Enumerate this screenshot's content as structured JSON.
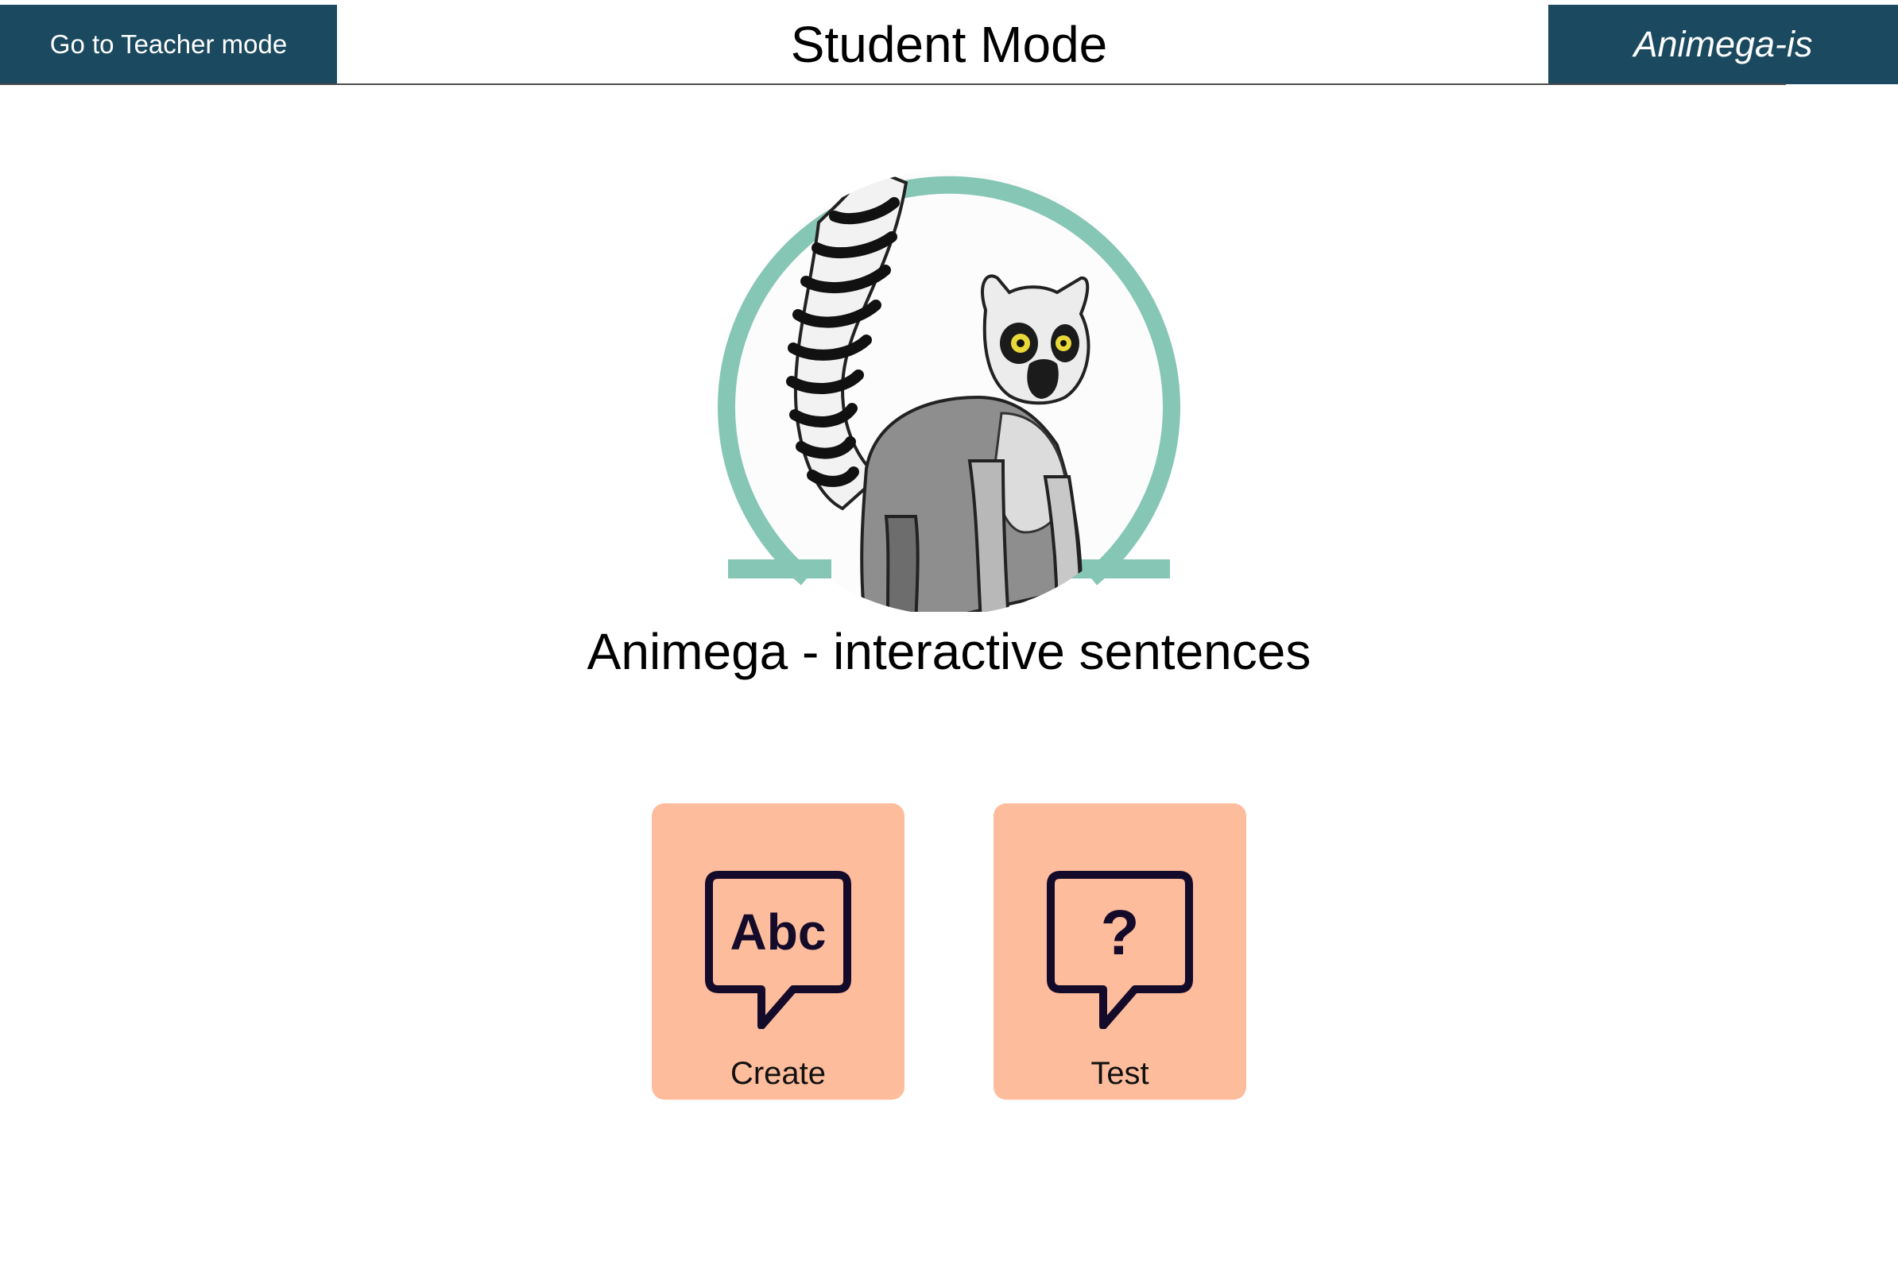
{
  "header": {
    "teacher_button_label": "Go to Teacher mode",
    "title": "Student Mode",
    "brand": "Animega-is"
  },
  "hero": {
    "icon": "lemur-illustration",
    "ring_color": "#86c6b5"
  },
  "app_name": "Animega - interactive sentences",
  "tiles": [
    {
      "label": "Create",
      "icon": "speech-bubble-abc-icon",
      "icon_text": "Abc"
    },
    {
      "label": "Test",
      "icon": "speech-bubble-question-icon",
      "icon_text": "?"
    }
  ],
  "colors": {
    "header_bg": "#1b4a60",
    "tile_bg": "#fdbc9c",
    "icon_stroke": "#140a2a"
  }
}
